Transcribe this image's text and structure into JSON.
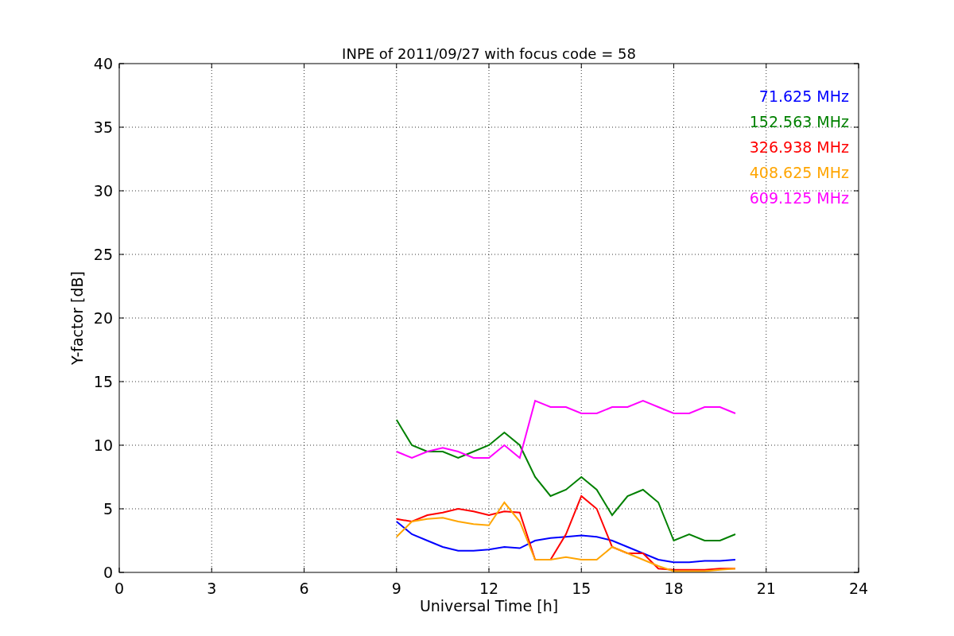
{
  "figure": {
    "chart_data": {
      "type": "line",
      "title": "INPE of 2011/09/27 with focus code = 58",
      "xlabel": "Universal Time [h]",
      "ylabel": "Y-factor [dB]",
      "x": [
        9,
        9.5,
        10,
        10.5,
        11,
        11.5,
        12,
        12.5,
        13,
        13.5,
        14,
        14.5,
        15,
        15.5,
        16,
        16.5,
        17,
        17.5,
        18,
        18.5,
        19,
        19.5,
        20
      ],
      "series": [
        {
          "name": "71.625 MHz",
          "color": "#0000ff",
          "values": [
            4,
            3,
            2.5,
            2,
            1.7,
            1.7,
            1.8,
            2,
            1.9,
            2.5,
            2.7,
            2.8,
            2.9,
            2.8,
            2.5,
            2,
            1.5,
            1,
            0.8,
            0.8,
            0.9,
            0.9,
            1
          ]
        },
        {
          "name": "152.563 MHz",
          "color": "#008000",
          "values": [
            12,
            10,
            9.5,
            9.5,
            9,
            9.5,
            10,
            11,
            10,
            7.5,
            6,
            6.5,
            7.5,
            6.5,
            4.5,
            6,
            6.5,
            5.5,
            2.5,
            3,
            2.5,
            2.5,
            3
          ]
        },
        {
          "name": "326.938 MHz",
          "color": "#ff0000",
          "values": [
            4.2,
            4,
            4.5,
            4.7,
            5,
            4.8,
            4.5,
            4.8,
            4.7,
            1,
            1,
            3,
            6,
            5,
            2,
            1.5,
            1.5,
            0.3,
            0.2,
            0.2,
            0.2,
            0.3,
            0.3
          ]
        },
        {
          "name": "408.625 MHz",
          "color": "#ffa500",
          "values": [
            2.8,
            4,
            4.2,
            4.3,
            4,
            3.8,
            3.7,
            5.5,
            4,
            1,
            1,
            1.2,
            1,
            1,
            2,
            1.5,
            1,
            0.5,
            0.1,
            0.1,
            0.1,
            0.2,
            0.3
          ]
        },
        {
          "name": "609.125 MHz",
          "color": "#ff00ff",
          "values": [
            9.5,
            9,
            9.5,
            9.8,
            9.5,
            9,
            9,
            10,
            9,
            13.5,
            13,
            13,
            12.5,
            12.5,
            13,
            13,
            13.5,
            13,
            12.5,
            12.5,
            13,
            13,
            12.5
          ]
        }
      ],
      "grid": true,
      "xlim": [
        0,
        24
      ],
      "ylim": [
        0,
        40
      ],
      "xticks": [
        0,
        3,
        6,
        9,
        12,
        15,
        18,
        21,
        24
      ],
      "yticks": [
        0,
        5,
        10,
        15,
        20,
        25,
        30,
        35,
        40
      ]
    }
  }
}
